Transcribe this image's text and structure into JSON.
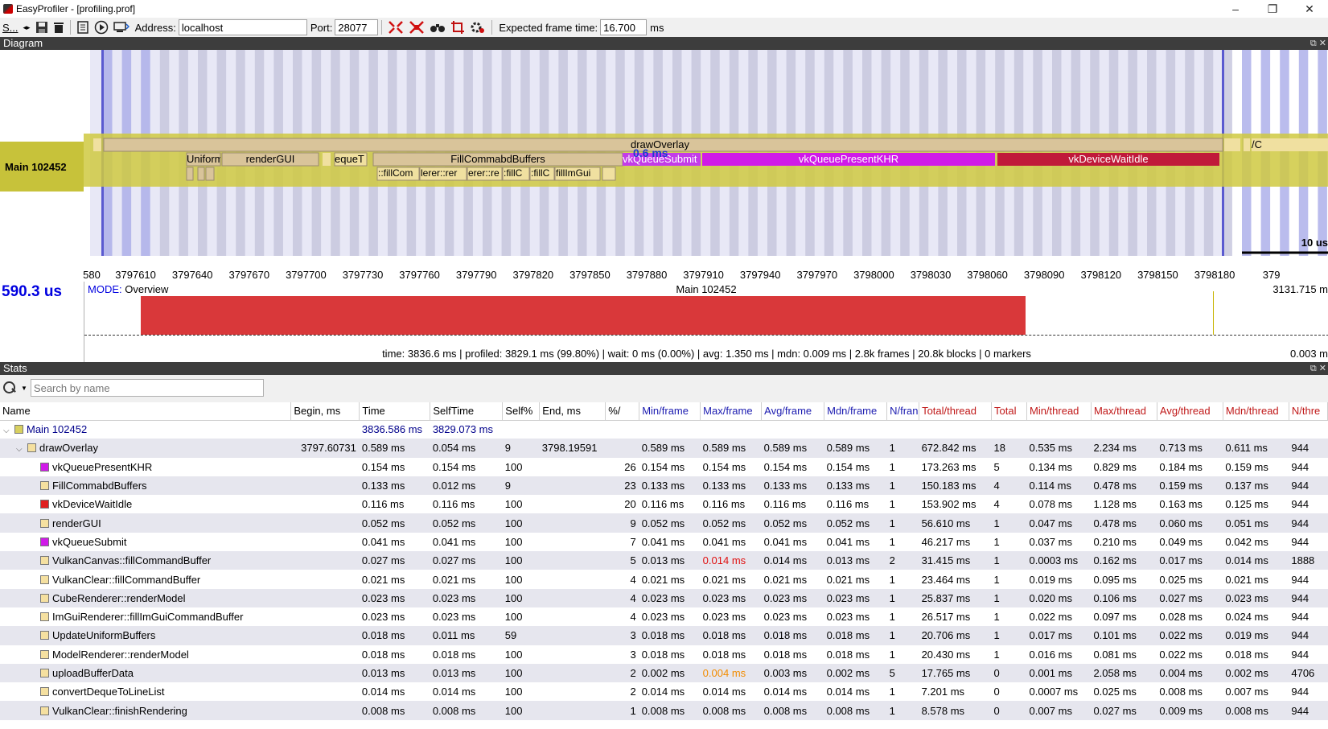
{
  "window": {
    "title": "EasyProfiler - [profiling.prof]",
    "min": "–",
    "max": "❐",
    "close": "✕"
  },
  "toolbar": {
    "session_label": "S...",
    "address_label": "Address:",
    "address_value": "localhost",
    "port_label": "Port:",
    "port_value": "28077",
    "frame_time_label": "Expected frame time:",
    "frame_time_value": "16.700",
    "frame_time_unit": "ms"
  },
  "diagram": {
    "header": "Diagram",
    "thread_name": "Main 102452",
    "blocks": {
      "top": "drawOverlay",
      "b1": "Uniform",
      "b2": "renderGUI",
      "b3": "equeT",
      "b4": "FillCommabdBuffers",
      "b5": "vkQueueSubmit",
      "b6": "vkQueuePresentKHR",
      "b7": "vkDeviceWaitIdle",
      "b8": "/C",
      "overlap_label": "0.6 ms",
      "s1": "::fillCom",
      "s2": "lerer::rer",
      "s3": "erer::re",
      "s4": ":fillC",
      "s5": ":fillC",
      "s6": "fillImGui"
    },
    "ruler": [
      "580",
      "3797610",
      "3797640",
      "3797670",
      "3797700",
      "3797730",
      "3797760",
      "3797790",
      "3797820",
      "3797850",
      "3797880",
      "3797910",
      "3797940",
      "3797970",
      "3798000",
      "3798030",
      "3798060",
      "3798090",
      "3798120",
      "3798150",
      "3798180",
      "379"
    ],
    "scale": "10 us"
  },
  "overview": {
    "selection_time": "590.3 us",
    "mode_label": "MODE:",
    "mode_value": "Overview",
    "thread": "Main 102452",
    "right_top": "3131.715 m",
    "right_low": "0.003 m",
    "status": "time: 3836.6 ms | profiled: 3829.1 ms (99.80%) | wait: 0 ms (0.00%) | avg: 1.350 ms | mdn: 0.009 ms | 2.8k frames | 20.8k blocks | 0 markers"
  },
  "stats": {
    "header": "Stats",
    "search_placeholder": "Search by name",
    "columns": [
      "Name",
      "Begin, ms",
      "Time",
      "SelfTime",
      "Self%",
      "End, ms",
      "%/",
      "Min/frame",
      "Max/frame",
      "Avg/frame",
      "Mdn/frame",
      "N/fran",
      "Total/thread",
      "Total",
      "Min/thread",
      "Max/thread",
      "Avg/thread",
      "Mdn/thread",
      "N/thre"
    ],
    "rows": [
      {
        "name": "Main 102452",
        "color": "#d8d060",
        "level": 0,
        "begin": "",
        "time": "3836.586 ms",
        "self": "3829.073 ms",
        "selfp": "",
        "end": "",
        "pct": "",
        "minf": "",
        "maxf": "",
        "avgf": "",
        "mdnf": "",
        "nf": "",
        "tot": "",
        "totp": "",
        "mint": "",
        "maxt": "",
        "avgt": "",
        "mdnt": "",
        "nt": ""
      },
      {
        "name": "drawOverlay",
        "color": "#f5e0a0",
        "level": 1,
        "begin": "3797.60731",
        "time": "0.589 ms",
        "self": "0.054 ms",
        "selfp": "9",
        "end": "3798.19591",
        "pct": "",
        "minf": "0.589 ms",
        "maxf": "0.589 ms",
        "avgf": "0.589 ms",
        "mdnf": "0.589 ms",
        "nf": "1",
        "tot": "672.842 ms",
        "totp": "18",
        "mint": "0.535 ms",
        "maxt": "2.234 ms",
        "avgt": "0.713 ms",
        "mdnt": "0.611 ms",
        "nt": "944"
      },
      {
        "name": "vkQueuePresentKHR",
        "color": "#d01ae8",
        "level": 2,
        "begin": "",
        "time": "0.154 ms",
        "self": "0.154 ms",
        "selfp": "100",
        "end": "",
        "pct": "26",
        "minf": "0.154 ms",
        "maxf": "0.154 ms",
        "avgf": "0.154 ms",
        "mdnf": "0.154 ms",
        "nf": "1",
        "tot": "173.263 ms",
        "totp": "5",
        "mint": "0.134 ms",
        "maxt": "0.829 ms",
        "avgt": "0.184 ms",
        "mdnt": "0.159 ms",
        "nt": "944"
      },
      {
        "name": "FillCommabdBuffers",
        "color": "#f5e0a0",
        "level": 2,
        "begin": "",
        "time": "0.133 ms",
        "self": "0.012 ms",
        "selfp": "9",
        "end": "",
        "pct": "23",
        "minf": "0.133 ms",
        "maxf": "0.133 ms",
        "avgf": "0.133 ms",
        "mdnf": "0.133 ms",
        "nf": "1",
        "tot": "150.183 ms",
        "totp": "4",
        "mint": "0.114 ms",
        "maxt": "0.478 ms",
        "avgt": "0.159 ms",
        "mdnt": "0.137 ms",
        "nt": "944"
      },
      {
        "name": "vkDeviceWaitIdle",
        "color": "#e02020",
        "level": 2,
        "begin": "",
        "time": "0.116 ms",
        "self": "0.116 ms",
        "selfp": "100",
        "end": "",
        "pct": "20",
        "minf": "0.116 ms",
        "maxf": "0.116 ms",
        "avgf": "0.116 ms",
        "mdnf": "0.116 ms",
        "nf": "1",
        "tot": "153.902 ms",
        "totp": "4",
        "mint": "0.078 ms",
        "maxt": "1.128 ms",
        "avgt": "0.163 ms",
        "mdnt": "0.125 ms",
        "nt": "944"
      },
      {
        "name": "renderGUI",
        "color": "#f5e0a0",
        "level": 2,
        "begin": "",
        "time": "0.052 ms",
        "self": "0.052 ms",
        "selfp": "100",
        "end": "",
        "pct": "9",
        "minf": "0.052 ms",
        "maxf": "0.052 ms",
        "avgf": "0.052 ms",
        "mdnf": "0.052 ms",
        "nf": "1",
        "tot": "56.610 ms",
        "totp": "1",
        "mint": "0.047 ms",
        "maxt": "0.478 ms",
        "avgt": "0.060 ms",
        "mdnt": "0.051 ms",
        "nt": "944"
      },
      {
        "name": "vkQueueSubmit",
        "color": "#d01ae8",
        "level": 2,
        "begin": "",
        "time": "0.041 ms",
        "self": "0.041 ms",
        "selfp": "100",
        "end": "",
        "pct": "7",
        "minf": "0.041 ms",
        "maxf": "0.041 ms",
        "avgf": "0.041 ms",
        "mdnf": "0.041 ms",
        "nf": "1",
        "tot": "46.217 ms",
        "totp": "1",
        "mint": "0.037 ms",
        "maxt": "0.210 ms",
        "avgt": "0.049 ms",
        "mdnt": "0.042 ms",
        "nt": "944"
      },
      {
        "name": "VulkanCanvas::fillCommandBuffer",
        "color": "#f5e0a0",
        "level": 2,
        "begin": "",
        "time": "0.027 ms",
        "self": "0.027 ms",
        "selfp": "100",
        "end": "",
        "pct": "5",
        "minf": "0.013 ms",
        "maxf": "0.014 ms",
        "maxf_color": "red",
        "avgf": "0.014 ms",
        "mdnf": "0.013 ms",
        "nf": "2",
        "tot": "31.415 ms",
        "totp": "1",
        "mint": "0.0003 ms",
        "maxt": "0.162 ms",
        "avgt": "0.017 ms",
        "mdnt": "0.014 ms",
        "nt": "1888"
      },
      {
        "name": "VulkanClear::fillCommandBuffer",
        "color": "#f5e0a0",
        "level": 2,
        "begin": "",
        "time": "0.021 ms",
        "self": "0.021 ms",
        "selfp": "100",
        "end": "",
        "pct": "4",
        "minf": "0.021 ms",
        "maxf": "0.021 ms",
        "avgf": "0.021 ms",
        "mdnf": "0.021 ms",
        "nf": "1",
        "tot": "23.464 ms",
        "totp": "1",
        "mint": "0.019 ms",
        "maxt": "0.095 ms",
        "avgt": "0.025 ms",
        "mdnt": "0.021 ms",
        "nt": "944"
      },
      {
        "name": "CubeRenderer::renderModel",
        "color": "#f5e0a0",
        "level": 2,
        "begin": "",
        "time": "0.023 ms",
        "self": "0.023 ms",
        "selfp": "100",
        "end": "",
        "pct": "4",
        "minf": "0.023 ms",
        "maxf": "0.023 ms",
        "avgf": "0.023 ms",
        "mdnf": "0.023 ms",
        "nf": "1",
        "tot": "25.837 ms",
        "totp": "1",
        "mint": "0.020 ms",
        "maxt": "0.106 ms",
        "avgt": "0.027 ms",
        "mdnt": "0.023 ms",
        "nt": "944"
      },
      {
        "name": "ImGuiRenderer::fillImGuiCommandBuffer",
        "color": "#f5e0a0",
        "level": 2,
        "begin": "",
        "time": "0.023 ms",
        "self": "0.023 ms",
        "selfp": "100",
        "end": "",
        "pct": "4",
        "minf": "0.023 ms",
        "maxf": "0.023 ms",
        "avgf": "0.023 ms",
        "mdnf": "0.023 ms",
        "nf": "1",
        "tot": "26.517 ms",
        "totp": "1",
        "mint": "0.022 ms",
        "maxt": "0.097 ms",
        "avgt": "0.028 ms",
        "mdnt": "0.024 ms",
        "nt": "944"
      },
      {
        "name": "UpdateUniformBuffers",
        "color": "#f5e0a0",
        "level": 2,
        "begin": "",
        "time": "0.018 ms",
        "self": "0.011 ms",
        "selfp": "59",
        "end": "",
        "pct": "3",
        "minf": "0.018 ms",
        "maxf": "0.018 ms",
        "avgf": "0.018 ms",
        "mdnf": "0.018 ms",
        "nf": "1",
        "tot": "20.706 ms",
        "totp": "1",
        "mint": "0.017 ms",
        "maxt": "0.101 ms",
        "avgt": "0.022 ms",
        "mdnt": "0.019 ms",
        "nt": "944"
      },
      {
        "name": "ModelRenderer::renderModel",
        "color": "#f5e0a0",
        "level": 2,
        "begin": "",
        "time": "0.018 ms",
        "self": "0.018 ms",
        "selfp": "100",
        "end": "",
        "pct": "3",
        "minf": "0.018 ms",
        "maxf": "0.018 ms",
        "avgf": "0.018 ms",
        "mdnf": "0.018 ms",
        "nf": "1",
        "tot": "20.430 ms",
        "totp": "1",
        "mint": "0.016 ms",
        "maxt": "0.081 ms",
        "avgt": "0.022 ms",
        "mdnt": "0.018 ms",
        "nt": "944"
      },
      {
        "name": "uploadBufferData",
        "color": "#f5e0a0",
        "level": 2,
        "begin": "",
        "time": "0.013 ms",
        "self": "0.013 ms",
        "selfp": "100",
        "end": "",
        "pct": "2",
        "minf": "0.002 ms",
        "maxf": "0.004 ms",
        "maxf_color": "orange",
        "avgf": "0.003 ms",
        "mdnf": "0.002 ms",
        "nf": "5",
        "tot": "17.765 ms",
        "totp": "0",
        "mint": "0.001 ms",
        "maxt": "2.058 ms",
        "avgt": "0.004 ms",
        "mdnt": "0.002 ms",
        "nt": "4706"
      },
      {
        "name": "convertDequeToLineList",
        "color": "#f5e0a0",
        "level": 2,
        "begin": "",
        "time": "0.014 ms",
        "self": "0.014 ms",
        "selfp": "100",
        "end": "",
        "pct": "2",
        "minf": "0.014 ms",
        "maxf": "0.014 ms",
        "avgf": "0.014 ms",
        "mdnf": "0.014 ms",
        "nf": "1",
        "tot": "7.201 ms",
        "totp": "0",
        "mint": "0.0007 ms",
        "maxt": "0.025 ms",
        "avgt": "0.008 ms",
        "mdnt": "0.007 ms",
        "nt": "944"
      },
      {
        "name": "VulkanClear::finishRendering",
        "color": "#f5e0a0",
        "level": 2,
        "begin": "",
        "time": "0.008 ms",
        "self": "0.008 ms",
        "selfp": "100",
        "end": "",
        "pct": "1",
        "minf": "0.008 ms",
        "maxf": "0.008 ms",
        "avgf": "0.008 ms",
        "mdnf": "0.008 ms",
        "nf": "1",
        "tot": "8.578 ms",
        "totp": "0",
        "mint": "0.007 ms",
        "maxt": "0.027 ms",
        "avgt": "0.009 ms",
        "mdnt": "0.008 ms",
        "nt": "944"
      }
    ]
  }
}
